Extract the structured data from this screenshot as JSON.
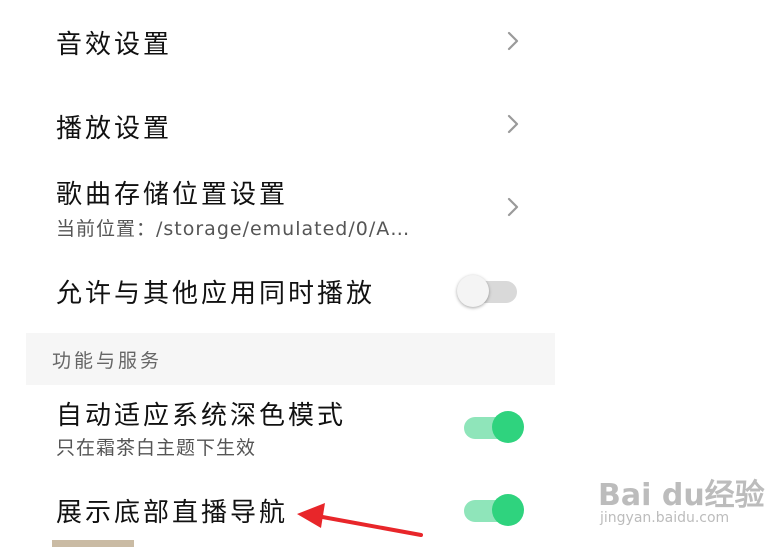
{
  "settings": {
    "sound_effects": {
      "title": "音效设置"
    },
    "playback": {
      "title": "播放设置"
    },
    "storage": {
      "title": "歌曲存储位置设置",
      "current_path": "当前位置：/storage/emulated/0/A…"
    },
    "mix_playback": {
      "title": "允许与其他应用同时播放",
      "enabled": false
    },
    "section_label": "功能与服务",
    "dark_mode": {
      "title": "自动适应系统深色模式",
      "subtitle": "只在霜茶白主题下生效",
      "enabled": true
    },
    "live_nav": {
      "title": "展示底部直播导航",
      "enabled": true
    }
  },
  "annotation": {
    "arrow_color": "#e8262a"
  },
  "watermark": {
    "main": "Bai du经验",
    "sub": "jingyan.baidu.com"
  },
  "colors": {
    "toggle_on": "#2fd37e",
    "toggle_on_track": "#8fe5ba",
    "toggle_off_track": "#d9d9d9"
  }
}
